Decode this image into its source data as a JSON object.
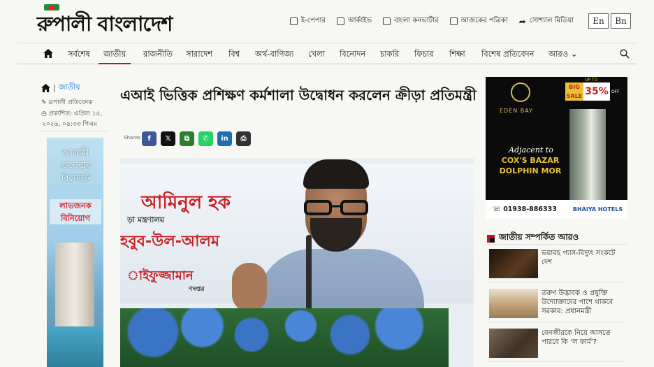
{
  "site": {
    "logo_text": "রুপালী বাংলাদেশ"
  },
  "toplinks": [
    {
      "label": "ই-পেপার",
      "icon": "newspaper-icon"
    },
    {
      "label": "আর্কাইভ",
      "icon": "folder-icon"
    },
    {
      "label": "বাংলা কনভার্টার",
      "icon": "document-icon"
    },
    {
      "label": "আজকের পত্রিকা",
      "icon": "paper-icon"
    },
    {
      "label": "সোশ্যাল মিডিয়া",
      "icon": "share-arrow-icon"
    }
  ],
  "lang": {
    "en": "En",
    "bn": "Bn"
  },
  "nav": {
    "items": [
      "সর্বশেষ",
      "জাতীয়",
      "রাজনীতি",
      "সারাদেশ",
      "বিশ্ব",
      "অর্থ-বাণিজ্য",
      "খেলা",
      "বিনোদন",
      "চাকরি",
      "ফিচার",
      "শিক্ষা",
      "বিশেষ প্রতিবেদন",
      "আরও"
    ],
    "active": "জাতীয়"
  },
  "breadcrumb": {
    "section": "জাতীয়"
  },
  "meta": {
    "author": "রূপালী প্রতিবেদক",
    "published_line1": "প্রকাশিত: এপ্রিল ১৫,",
    "published_line2": "২০২৬, ০৪:৩৩ পিএম"
  },
  "left_ad": {
    "line1": "আগামী প্রজন্মের রিসোর্টে",
    "line2": "লাভজনক বিনিয়োগ"
  },
  "article": {
    "title": "এআই ভিত্তিক প্রশিক্ষণ কর্মশালা উদ্বোধন করলেন ক্রীড়া প্রতিমন্ত্রী",
    "shares_label": "Shares",
    "banner_lines": [
      "আমিনুল হক",
      "ড়া মন্ত্রণালয়",
      "হবুব-উল-আলম",
      "াইফুজ্জামান",
      "ণদপ্তর"
    ]
  },
  "share_buttons": [
    {
      "name": "facebook",
      "glyph": "f",
      "color": "#3b5998"
    },
    {
      "name": "x",
      "glyph": "𝕏",
      "color": "#111111"
    },
    {
      "name": "copy",
      "glyph": "⧉",
      "color": "#2e7d32"
    },
    {
      "name": "whatsapp",
      "glyph": "✆",
      "color": "#25d366"
    },
    {
      "name": "linkedin",
      "glyph": "in",
      "color": "#1e6fb0"
    },
    {
      "name": "print",
      "glyph": "⎙",
      "color": "#333333"
    }
  ],
  "right_ad": {
    "brand": "EDEN BAY",
    "sale": "BIG SALE",
    "upto": "UP TO",
    "percent": "35%",
    "off": "OFF",
    "adjacent": "Adjacent to",
    "location": "COX'S BAZAR DOLPHIN MOR",
    "phone": "01938-886333",
    "partner": "BHAIYA HOTELS"
  },
  "related": {
    "heading": "জাতীয় সম্পর্কিত আরও",
    "items": [
      {
        "text": "ভয়াবহ গ্যাস-বিদ্যুৎ সংকটে দেশ",
        "thumb_color": "#2a1b12"
      },
      {
        "text": "তরুণ উদ্ভাবক ও প্রযুক্তি উদ্যোক্তাদের পাশে থাকবে সরকার: প্রধানমন্ত্রী",
        "thumb_color": "#c6a77c"
      },
      {
        "text": "বেনজীরকে নিয়ে আসতে পারবে কি ‘ল ফার্ম’?",
        "thumb_color": "#5a4a38"
      }
    ]
  }
}
